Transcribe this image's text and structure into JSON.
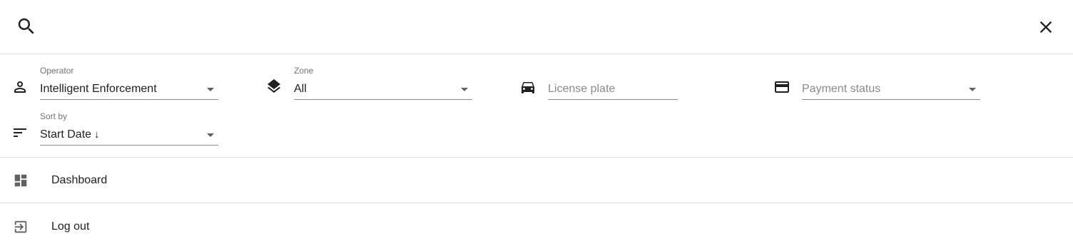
{
  "search": {
    "value": "",
    "placeholder": "",
    "icon": "search-icon",
    "close_icon": "close-icon"
  },
  "filters": {
    "operator": {
      "label": "Operator",
      "value": "Intelligent Enforcement",
      "icon": "person-icon"
    },
    "zone": {
      "label": "Zone",
      "value": "All",
      "icon": "layers-icon"
    },
    "license_plate": {
      "placeholder": "License plate",
      "icon": "car-icon"
    },
    "payment_status": {
      "placeholder": "Payment status",
      "icon": "credit-card-icon"
    },
    "sort_by": {
      "label": "Sort by",
      "value": "Start Date",
      "direction_glyph": "↓",
      "icon": "sort-icon"
    }
  },
  "nav": [
    {
      "label": "Dashboard",
      "icon": "dashboard-icon"
    },
    {
      "label": "Log out",
      "icon": "logout-icon"
    }
  ],
  "colors": {
    "text": "#212121",
    "secondary_text": "#757575",
    "divider": "#e0e0e0",
    "icon": "#616161"
  }
}
